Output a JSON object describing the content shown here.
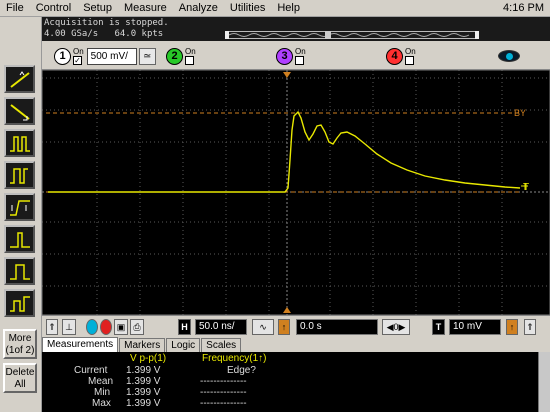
{
  "menu": [
    "File",
    "Control",
    "Setup",
    "Measure",
    "Analyze",
    "Utilities",
    "Help"
  ],
  "clock": "4:16 PM",
  "status": {
    "line1": "Acquisition is stopped.",
    "line2": "4.00 GSa/s   64.0 kpts"
  },
  "channels": [
    {
      "num": "1",
      "on_label": "On",
      "checked": true,
      "scale": "500 mV/",
      "color": "#e8e800"
    },
    {
      "num": "2",
      "on_label": "On",
      "checked": false,
      "color": "#00d000"
    },
    {
      "num": "3",
      "on_label": "On",
      "checked": false,
      "color": "#b040ff"
    },
    {
      "num": "4",
      "on_label": "On",
      "checked": false,
      "color": "#ff3030"
    }
  ],
  "markers": {
    "top_right": "BY",
    "right": "T"
  },
  "side_buttons": {
    "more": "More\n(1of 2)",
    "delete": "Delete\nAll"
  },
  "horizontal": {
    "label": "H",
    "scale": "50.0 ns/",
    "position": "0.0 s",
    "trig_label": "T",
    "trig_level": "10 mV"
  },
  "tabs": [
    "Measurements",
    "Markers",
    "Logic",
    "Scales"
  ],
  "measurements": {
    "headers": [
      "V p-p(1)",
      "Frequency(1↑)"
    ],
    "rows": [
      {
        "label": "Current",
        "v": "1.399 V",
        "f": "Edge?"
      },
      {
        "label": "Mean",
        "v": "1.399 V",
        "f": "--------------"
      },
      {
        "label": "Min",
        "v": "1.399 V",
        "f": "--------------"
      },
      {
        "label": "Max",
        "v": "1.399 V",
        "f": "--------------"
      }
    ]
  },
  "colors": {
    "trace": "#e8e800",
    "marker": "#d08020",
    "grid": "#5a5a5a"
  }
}
